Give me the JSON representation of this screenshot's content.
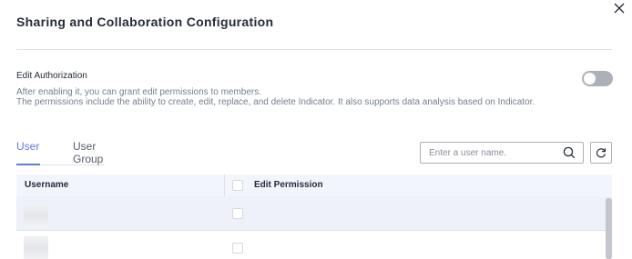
{
  "dialog": {
    "title": "Sharing and Collaboration Configuration",
    "close_icon": "close-icon"
  },
  "edit_authorization": {
    "label": "Edit Authorization",
    "description_line1": "After enabling it, you can grant edit permissions to members.",
    "description_line2": "The permissions include the ability to create, edit, replace, and delete Indicator. It also supports data analysis based on Indicator.",
    "enabled": false
  },
  "tabs": [
    {
      "label": "User",
      "active": true
    },
    {
      "label": "User Group",
      "active": false
    }
  ],
  "search": {
    "placeholder": "Enter a user name.",
    "value": "",
    "icon": "search-icon"
  },
  "refresh": {
    "icon": "refresh-icon"
  },
  "table": {
    "columns": [
      "Username",
      "Edit Permission"
    ],
    "rows": [
      {
        "username": "",
        "edit_permission": false
      },
      {
        "username": "",
        "edit_permission": false
      }
    ]
  },
  "colors": {
    "accent": "#5e7ce0",
    "header_bg": "#f2f5fc",
    "selected_row_bg": "#eef1fa",
    "toggle_off": "#adb0b8"
  }
}
